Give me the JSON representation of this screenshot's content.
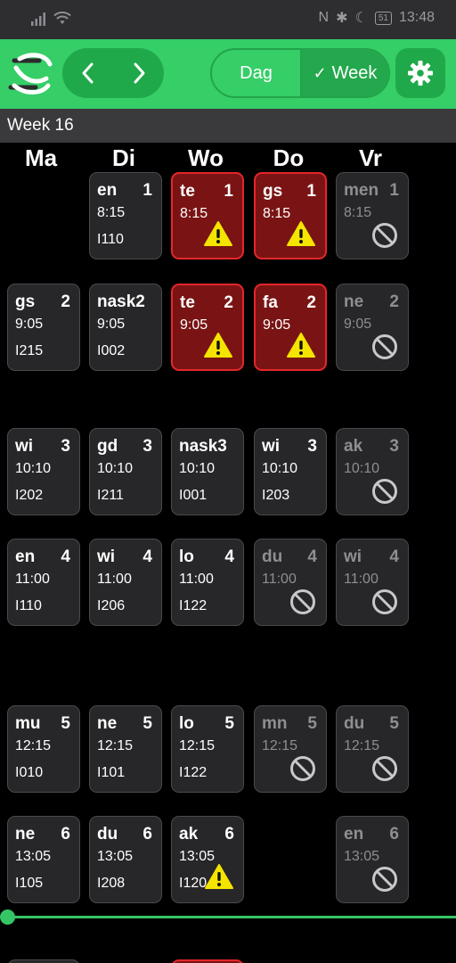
{
  "status_bar": {
    "time": "13:48",
    "battery": "51"
  },
  "toolbar": {
    "view_day": "Dag",
    "view_week": "Week",
    "view_week_check": "✓"
  },
  "week_label": "Week 16",
  "days": [
    "Ma",
    "Di",
    "Wo",
    "Do",
    "Vr"
  ],
  "lessons": [
    {
      "day": "Di",
      "subject": "en",
      "hour": "1",
      "time": "8:15",
      "room": "I110",
      "state": "normal"
    },
    {
      "day": "Wo",
      "subject": "te",
      "hour": "1",
      "time": "8:15",
      "room": "",
      "state": "warning"
    },
    {
      "day": "Do",
      "subject": "gs",
      "hour": "1",
      "time": "8:15",
      "room": "",
      "state": "warning"
    },
    {
      "day": "Vr",
      "subject": "men",
      "hour": "1",
      "time": "8:15",
      "room": "",
      "state": "cancelled"
    },
    {
      "day": "Ma",
      "subject": "gs",
      "hour": "2",
      "time": "9:05",
      "room": "I215",
      "state": "normal"
    },
    {
      "day": "Di",
      "subject": "nask2",
      "hour": "",
      "time": "9:05",
      "room": "I002",
      "state": "normal"
    },
    {
      "day": "Wo",
      "subject": "te",
      "hour": "2",
      "time": "9:05",
      "room": "",
      "state": "warning"
    },
    {
      "day": "Do",
      "subject": "fa",
      "hour": "2",
      "time": "9:05",
      "room": "",
      "state": "warning"
    },
    {
      "day": "Vr",
      "subject": "ne",
      "hour": "2",
      "time": "9:05",
      "room": "",
      "state": "cancelled"
    },
    {
      "day": "Ma",
      "subject": "wi",
      "hour": "3",
      "time": "10:10",
      "room": "I202",
      "state": "normal"
    },
    {
      "day": "Di",
      "subject": "gd",
      "hour": "3",
      "time": "10:10",
      "room": "I211",
      "state": "normal"
    },
    {
      "day": "Wo",
      "subject": "nask3",
      "hour": "",
      "time": "10:10",
      "room": "I001",
      "state": "normal"
    },
    {
      "day": "Do",
      "subject": "wi",
      "hour": "3",
      "time": "10:10",
      "room": "I203",
      "state": "normal"
    },
    {
      "day": "Vr",
      "subject": "ak",
      "hour": "3",
      "time": "10:10",
      "room": "",
      "state": "cancelled"
    },
    {
      "day": "Ma",
      "subject": "en",
      "hour": "4",
      "time": "11:00",
      "room": "I110",
      "state": "normal"
    },
    {
      "day": "Di",
      "subject": "wi",
      "hour": "4",
      "time": "11:00",
      "room": "I206",
      "state": "normal"
    },
    {
      "day": "Wo",
      "subject": "lo",
      "hour": "4",
      "time": "11:00",
      "room": "I122",
      "state": "normal"
    },
    {
      "day": "Do",
      "subject": "du",
      "hour": "4",
      "time": "11:00",
      "room": "",
      "state": "cancelled"
    },
    {
      "day": "Vr",
      "subject": "wi",
      "hour": "4",
      "time": "11:00",
      "room": "",
      "state": "cancelled"
    },
    {
      "day": "Ma",
      "subject": "mu",
      "hour": "5",
      "time": "12:15",
      "room": "I010",
      "state": "normal"
    },
    {
      "day": "Di",
      "subject": "ne",
      "hour": "5",
      "time": "12:15",
      "room": "I101",
      "state": "normal"
    },
    {
      "day": "Wo",
      "subject": "lo",
      "hour": "5",
      "time": "12:15",
      "room": "I122",
      "state": "normal"
    },
    {
      "day": "Do",
      "subject": "mn",
      "hour": "5",
      "time": "12:15",
      "room": "",
      "state": "cancelled"
    },
    {
      "day": "Vr",
      "subject": "du",
      "hour": "5",
      "time": "12:15",
      "room": "",
      "state": "cancelled"
    },
    {
      "day": "Ma",
      "subject": "ne",
      "hour": "6",
      "time": "13:05",
      "room": "I105",
      "state": "normal"
    },
    {
      "day": "Di",
      "subject": "du",
      "hour": "6",
      "time": "13:05",
      "room": "I208",
      "state": "normal"
    },
    {
      "day": "Wo",
      "subject": "ak",
      "hour": "6",
      "time": "13:05",
      "room": "I120",
      "state": "warning-inline"
    },
    {
      "day": "Vr",
      "subject": "en",
      "hour": "6",
      "time": "13:05",
      "room": "",
      "state": "cancelled"
    }
  ],
  "colors": {
    "accent": "#36ce67",
    "warning_bg": "#7a1414",
    "warning_border": "#e5262a",
    "cell_bg": "#27272a"
  },
  "icons": {
    "logo": "app-logo",
    "prev": "chevron-left-icon",
    "next": "chevron-right-icon",
    "settings": "gear-icon",
    "warning": "warning-icon",
    "cancelled": "cancelled-icon"
  }
}
